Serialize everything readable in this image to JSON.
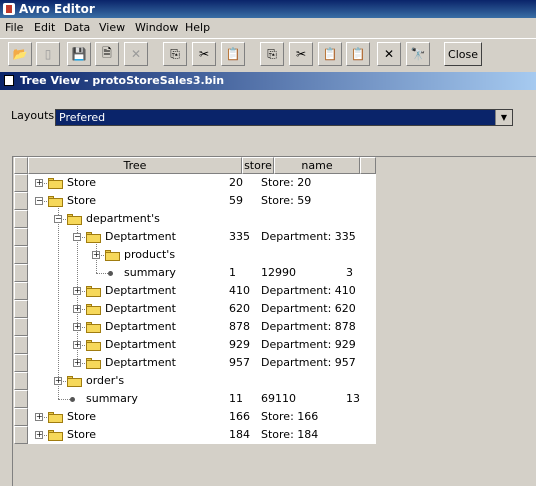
{
  "window": {
    "title": "Avro Editor"
  },
  "menu": [
    "File",
    "Edit",
    "Data",
    "View",
    "Window",
    "Help"
  ],
  "toolbar": {
    "buttons": [
      {
        "name": "open-icon",
        "glyph": "📂",
        "enabled": true
      },
      {
        "name": "new-icon",
        "glyph": "▯",
        "enabled": false
      },
      {
        "name": "save-icon",
        "glyph": "💾",
        "enabled": true
      },
      {
        "name": "save-as-icon",
        "glyph": "🗎",
        "enabled": true
      },
      {
        "name": "delete-icon",
        "glyph": "✕",
        "enabled": false
      },
      {
        "name": "copy-icon",
        "glyph": "⎘",
        "enabled": true
      },
      {
        "name": "cut-icon",
        "glyph": "✂",
        "enabled": true
      },
      {
        "name": "paste-icon",
        "glyph": "📋",
        "enabled": true
      },
      {
        "name": "copy-field-icon",
        "glyph": "⎘",
        "enabled": true
      },
      {
        "name": "cut-field-icon",
        "glyph": "✂",
        "enabled": true
      },
      {
        "name": "paste-field-icon",
        "glyph": "📋",
        "enabled": true
      },
      {
        "name": "paste-field-after-icon",
        "glyph": "📋",
        "enabled": true
      },
      {
        "name": "delete-field-icon",
        "glyph": "✕",
        "enabled": true
      },
      {
        "name": "search-icon",
        "glyph": "🔭",
        "enabled": true
      }
    ],
    "close_label": "Close"
  },
  "internal_frame": {
    "title": "Tree View - protoStoreSales3.bin"
  },
  "layouts": {
    "label": "Layouts",
    "selected": "Prefered"
  },
  "table": {
    "columns": [
      "Tree",
      "store",
      "name",
      ""
    ],
    "rows": [
      {
        "depth": 0,
        "expander": "+",
        "kind": "folder",
        "label": "Store",
        "store": "20",
        "name": "Store: 20",
        "extra": ""
      },
      {
        "depth": 0,
        "expander": "-",
        "kind": "folder",
        "label": "Store",
        "store": "59",
        "name": "Store: 59",
        "extra": ""
      },
      {
        "depth": 1,
        "expander": "-",
        "kind": "folder",
        "label": "department's",
        "store": "",
        "name": "",
        "extra": ""
      },
      {
        "depth": 2,
        "expander": "-",
        "kind": "folder",
        "label": "Deptartment",
        "store": "335",
        "name": "Department: 335",
        "extra": ""
      },
      {
        "depth": 3,
        "expander": "+",
        "kind": "folder",
        "label": "product's",
        "store": "",
        "name": "",
        "extra": ""
      },
      {
        "depth": 3,
        "expander": "",
        "kind": "leaf",
        "label": "summary",
        "store": "1",
        "name": "12990",
        "extra": "3"
      },
      {
        "depth": 2,
        "expander": "+",
        "kind": "folder",
        "label": "Deptartment",
        "store": "410",
        "name": "Department: 410",
        "extra": ""
      },
      {
        "depth": 2,
        "expander": "+",
        "kind": "folder",
        "label": "Deptartment",
        "store": "620",
        "name": "Department: 620",
        "extra": ""
      },
      {
        "depth": 2,
        "expander": "+",
        "kind": "folder",
        "label": "Deptartment",
        "store": "878",
        "name": "Department: 878",
        "extra": ""
      },
      {
        "depth": 2,
        "expander": "+",
        "kind": "folder",
        "label": "Deptartment",
        "store": "929",
        "name": "Department: 929",
        "extra": ""
      },
      {
        "depth": 2,
        "expander": "+",
        "kind": "folder",
        "label": "Deptartment",
        "store": "957",
        "name": "Department: 957",
        "extra": ""
      },
      {
        "depth": 1,
        "expander": "+",
        "kind": "folder",
        "label": "order's",
        "store": "",
        "name": "",
        "extra": ""
      },
      {
        "depth": 1,
        "expander": "",
        "kind": "leaf",
        "label": "summary",
        "store": "11",
        "name": "69110",
        "extra": "13"
      },
      {
        "depth": 0,
        "expander": "+",
        "kind": "folder",
        "label": "Store",
        "store": "166",
        "name": "Store: 166",
        "extra": ""
      },
      {
        "depth": 0,
        "expander": "+",
        "kind": "folder",
        "label": "Store",
        "store": "184",
        "name": "Store: 184",
        "extra": ""
      }
    ]
  }
}
